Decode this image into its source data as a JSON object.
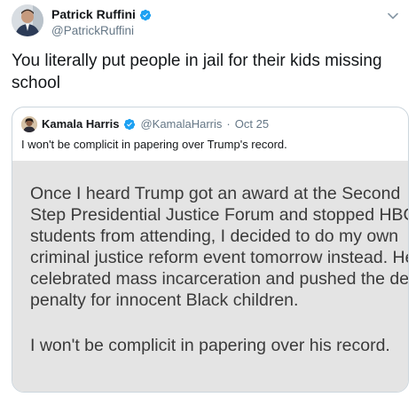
{
  "tweet": {
    "author_name": "Patrick Ruffini",
    "author_handle": "@PatrickRuffini",
    "text_lines": [
      "You literally put people in jail for their kids missing",
      "school"
    ]
  },
  "quoted_tweet": {
    "author_name": "Kamala Harris",
    "author_handle": "@KamalaHarris",
    "separator": "·",
    "date": "Oct 25",
    "text": "I won't be complicit in papering over Trump's record.",
    "image_text": {
      "paragraph1_lines": [
        "Once I heard Trump got an award at the Second",
        "Step Presidential Justice Forum and stopped HBC",
        "students from attending, I decided to do my own",
        "criminal justice reform event tomorrow instead. He",
        "celebrated mass incarceration and pushed the dea",
        "penalty for innocent Black children."
      ],
      "paragraph2_lines": [
        "I won't be complicit in papering over his record."
      ]
    }
  },
  "icons": {
    "verified": "verified-badge-icon",
    "caret": "chevron-down-icon"
  },
  "colors": {
    "verified_blue": "#1da1f2",
    "secondary_text": "#657786",
    "border": "#ccd6dd",
    "image_background": "#e4e4e4"
  }
}
